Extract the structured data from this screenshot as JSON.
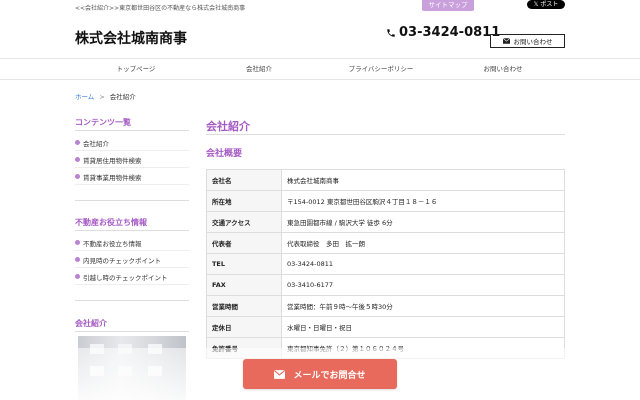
{
  "header": {
    "tagline": "<<会社紹介>>東京都世田谷区の不動産なら株式会社城南商事",
    "sitemap_label": "サイトマップ",
    "xpost_label": "ポスト",
    "site_title": "株式会社城南商事",
    "phone": "03-3424-0811",
    "contact_label": "お問い合わせ"
  },
  "nav": {
    "items": [
      {
        "label": "トップページ"
      },
      {
        "label": "会社紹介"
      },
      {
        "label": "プライバシーポリシー"
      },
      {
        "label": "お問い合わせ"
      }
    ]
  },
  "breadcrumb": {
    "home": "ホーム",
    "separator": ">",
    "current": "会社紹介"
  },
  "sidebar": {
    "contents_heading": "コンテンツ一覧",
    "contents_items": [
      {
        "label": "会社紹介"
      },
      {
        "label": "賃貸居住用物件検索"
      },
      {
        "label": "賃貸事業用物件検索"
      }
    ],
    "tips_heading": "不動産お役立ち情報",
    "tips_items": [
      {
        "label": "不動産お役立ち情報"
      },
      {
        "label": "内見時のチェックポイント"
      },
      {
        "label": "引越し時のチェックポイント"
      }
    ],
    "intro_heading": "会社紹介"
  },
  "main": {
    "title": "会社紹介",
    "subtitle": "会社概要",
    "rows": [
      {
        "key": "会社名",
        "value": "株式会社城南商事"
      },
      {
        "key": "所在地",
        "value": "〒154-0012 東京都世田谷区駒沢４丁目１８－１６"
      },
      {
        "key": "交通アクセス",
        "value": "東急田園都市線 / 駒沢大学 徒歩 6分"
      },
      {
        "key": "代表者",
        "value": "代表取締役　多田　拡一朗"
      },
      {
        "key": "TEL",
        "value": "03-3424-0811"
      },
      {
        "key": "FAX",
        "value": "03-3410-6177"
      },
      {
        "key": "営業時間",
        "value": "営業時間：午前９時〜午後５時30分"
      },
      {
        "key": "定休日",
        "value": "水曜日・日曜日・祝日"
      },
      {
        "key": "免許番号",
        "value": "東京都知事免許（２）第１０６０２４号"
      }
    ]
  },
  "cta": {
    "mail_label": "メールでお問合せ"
  },
  "colors": {
    "accent": "#a65bc4",
    "sitemap_bg": "#c9a0dc",
    "cta_bg": "#e86a5c",
    "link": "#3a7bd5"
  }
}
